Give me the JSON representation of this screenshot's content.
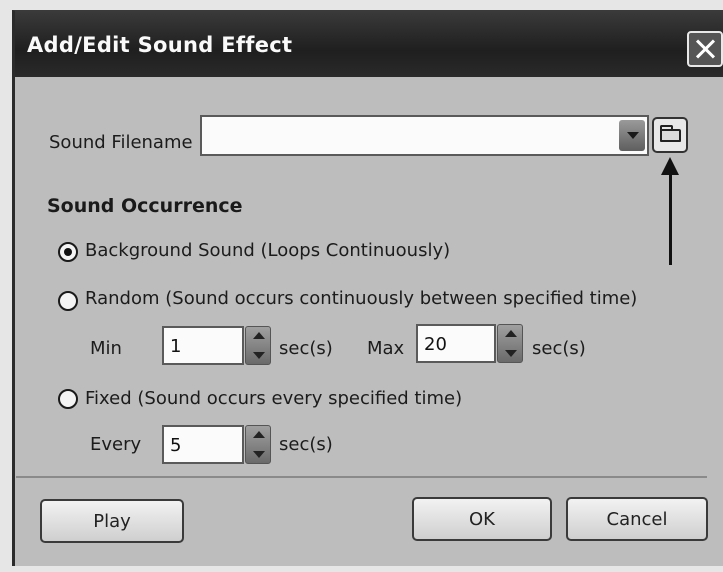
{
  "window": {
    "title": "Add/Edit Sound Effect"
  },
  "sound_file": {
    "label": "Sound Filename",
    "value": ""
  },
  "occurrence": {
    "heading": "Sound Occurrence",
    "options": [
      {
        "label": "Background Sound (Loops Continuously)",
        "selected": true
      },
      {
        "label": "Random (Sound occurs continuously between specified time)",
        "selected": false
      },
      {
        "label": "Fixed (Sound occurs every specified time)",
        "selected": false
      }
    ],
    "random": {
      "min_label": "Min",
      "min_value": "1",
      "min_unit": "sec(s)",
      "max_label": "Max",
      "max_value": "20",
      "max_unit": "sec(s)"
    },
    "fixed": {
      "every_label": "Every",
      "every_value": "5",
      "every_unit": "sec(s)"
    }
  },
  "buttons": {
    "play": "Play",
    "ok": "OK",
    "cancel": "Cancel"
  },
  "icons": {
    "browse": "folder-open-icon",
    "close": "close-icon"
  }
}
